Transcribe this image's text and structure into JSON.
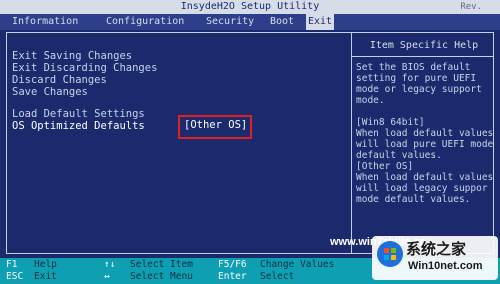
{
  "title": "InsydeH2O Setup Utility",
  "version": "Rev.",
  "tabs": [
    "Information",
    "Configuration",
    "Security",
    "Boot",
    "Exit"
  ],
  "active_tab": "Exit",
  "menu_items": [
    "Exit Saving Changes",
    "Exit Discarding Changes",
    "Discard Changes",
    "Save Changes",
    "Load Default Settings",
    "OS Optimized Defaults"
  ],
  "selected_value": "[Other OS]",
  "help": {
    "title": "Item Specific Help",
    "lines": [
      "Set the BIOS default",
      "setting for pure UEFI",
      "mode or legacy support",
      "mode.",
      "",
      "[Win8 64bit]",
      "When load default values",
      " will load pure UEFI mode",
      " default values.",
      "[Other OS]",
      "When load default values",
      " will load legacy suppor",
      " mode default values."
    ]
  },
  "footer": [
    {
      "key": "F1",
      "desc": "Help"
    },
    {
      "key": "ESC",
      "desc": "Exit"
    },
    {
      "key": "↑↓",
      "desc": "Select Item"
    },
    {
      "key": "↔",
      "desc": "Select Menu"
    },
    {
      "key": "F5/F6",
      "desc": "Change Values"
    },
    {
      "key": "Enter",
      "desc": "Select"
    }
  ],
  "watermark": {
    "url": "www.win7zhijia.cn",
    "brand": "系统之家",
    "brand_url": "Win10net.com"
  },
  "colors": {
    "background": "#1b2a6c",
    "highlight_box": "#e02020",
    "footer": "#0e9fb3"
  }
}
